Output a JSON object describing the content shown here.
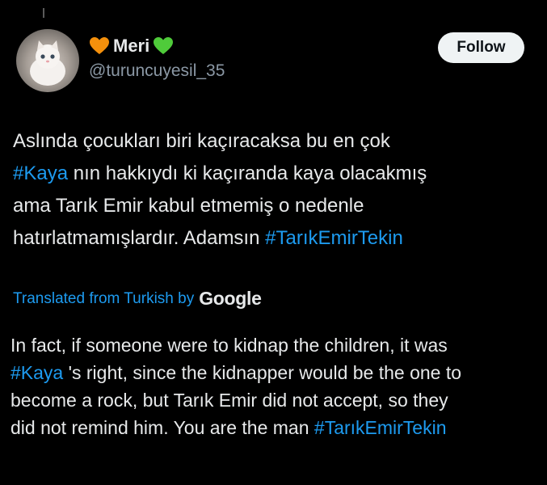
{
  "author": {
    "display_name": "Meri",
    "handle": "@turuncuyesil_35",
    "prefix_emoji": "orange-heart",
    "suffix_emoji": "green-heart"
  },
  "follow_button": {
    "label": "Follow"
  },
  "tweet": {
    "lines": [
      [
        {
          "text": "Aslında çocukları biri kaçıracaksa bu en çok",
          "hashtag": false
        }
      ],
      [
        {
          "text": "#Kaya",
          "hashtag": true
        },
        {
          "text": " nın hakkıydı ki kaçıranda kaya olacakmış",
          "hashtag": false
        }
      ],
      [
        {
          "text": "ama Tarık Emir kabul etmemiş o nedenle",
          "hashtag": false
        }
      ],
      [
        {
          "text": "hatırlatmamışlardır. Adamsın ",
          "hashtag": false
        },
        {
          "text": "#TarıkEmirTekin",
          "hashtag": true
        }
      ]
    ]
  },
  "translation_label": {
    "text": "Translated from Turkish by",
    "provider": "Google"
  },
  "translation": {
    "lines": [
      [
        {
          "text": "In fact, if someone were to kidnap the children, it was",
          "hashtag": false
        }
      ],
      [
        {
          "text": "#Kaya",
          "hashtag": true
        },
        {
          "text": " 's right, since the kidnapper would be the one to",
          "hashtag": false
        }
      ],
      [
        {
          "text": "become a rock, but Tarık Emir did not accept, so they",
          "hashtag": false
        }
      ],
      [
        {
          "text": "did not remind him. You are the man ",
          "hashtag": false
        },
        {
          "text": "#TarıkEmirTekin",
          "hashtag": true
        }
      ]
    ]
  },
  "colors": {
    "background": "#000000",
    "text": "#e7e9ea",
    "secondary": "#8b98a5",
    "link": "#1d9bf0",
    "button_bg": "#eff3f4",
    "orange_heart": "#f4900c",
    "green_heart": "#4fcb3a"
  }
}
